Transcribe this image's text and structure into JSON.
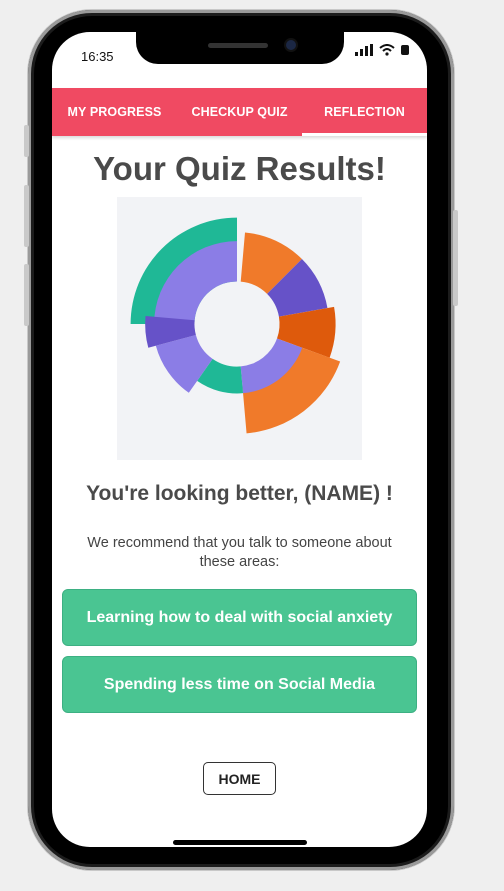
{
  "status_bar": {
    "time": "16:35"
  },
  "tabs": [
    {
      "label": "MY PROGRESS",
      "active": false
    },
    {
      "label": "CHECKUP QUIZ",
      "active": false
    },
    {
      "label": "REFLECTION",
      "active": true
    }
  ],
  "main": {
    "title": "Your Quiz Results!",
    "subtitle": "You're looking better, (NAME) !",
    "recommend_text": "We recommend that you talk to someone about these areas:",
    "topics": [
      "Learning how to deal with social anxiety",
      "Spending less time on Social Media"
    ],
    "home_label": "HOME"
  },
  "colors": {
    "accent": "#f04a62",
    "button_green": "#4ac592",
    "chart_teal": "#1fb896",
    "chart_purple": "#8b7de6",
    "chart_dark_purple": "#6652c8",
    "chart_orange": "#f07a2a",
    "chart_dark_orange": "#de5a0c"
  },
  "chart_data": {
    "type": "polar-area",
    "segments": [
      {
        "color": "#1fb896",
        "start": 270,
        "end": 360,
        "inner": 0.38,
        "outer": 0.95
      },
      {
        "color": "#8b7de6",
        "start": 270,
        "end": 360,
        "inner": 0.38,
        "outer": 0.74
      },
      {
        "color": "#f07a2a",
        "start": 5,
        "end": 45,
        "inner": 0.38,
        "outer": 0.82
      },
      {
        "color": "#6652c8",
        "start": 45,
        "end": 80,
        "inner": 0.38,
        "outer": 0.82
      },
      {
        "color": "#de5a0c",
        "start": 80,
        "end": 110,
        "inner": 0.38,
        "outer": 0.88
      },
      {
        "color": "#f07a2a",
        "start": 110,
        "end": 175,
        "inner": 0.55,
        "outer": 0.98
      },
      {
        "color": "#8b7de6",
        "start": 110,
        "end": 175,
        "inner": 0.38,
        "outer": 0.62
      },
      {
        "color": "#1fb896",
        "start": 175,
        "end": 215,
        "inner": 0.38,
        "outer": 0.62
      },
      {
        "color": "#8b7de6",
        "start": 215,
        "end": 255,
        "inner": 0.38,
        "outer": 0.75
      },
      {
        "color": "#6652c8",
        "start": 255,
        "end": 275,
        "inner": 0.38,
        "outer": 0.82
      }
    ]
  }
}
